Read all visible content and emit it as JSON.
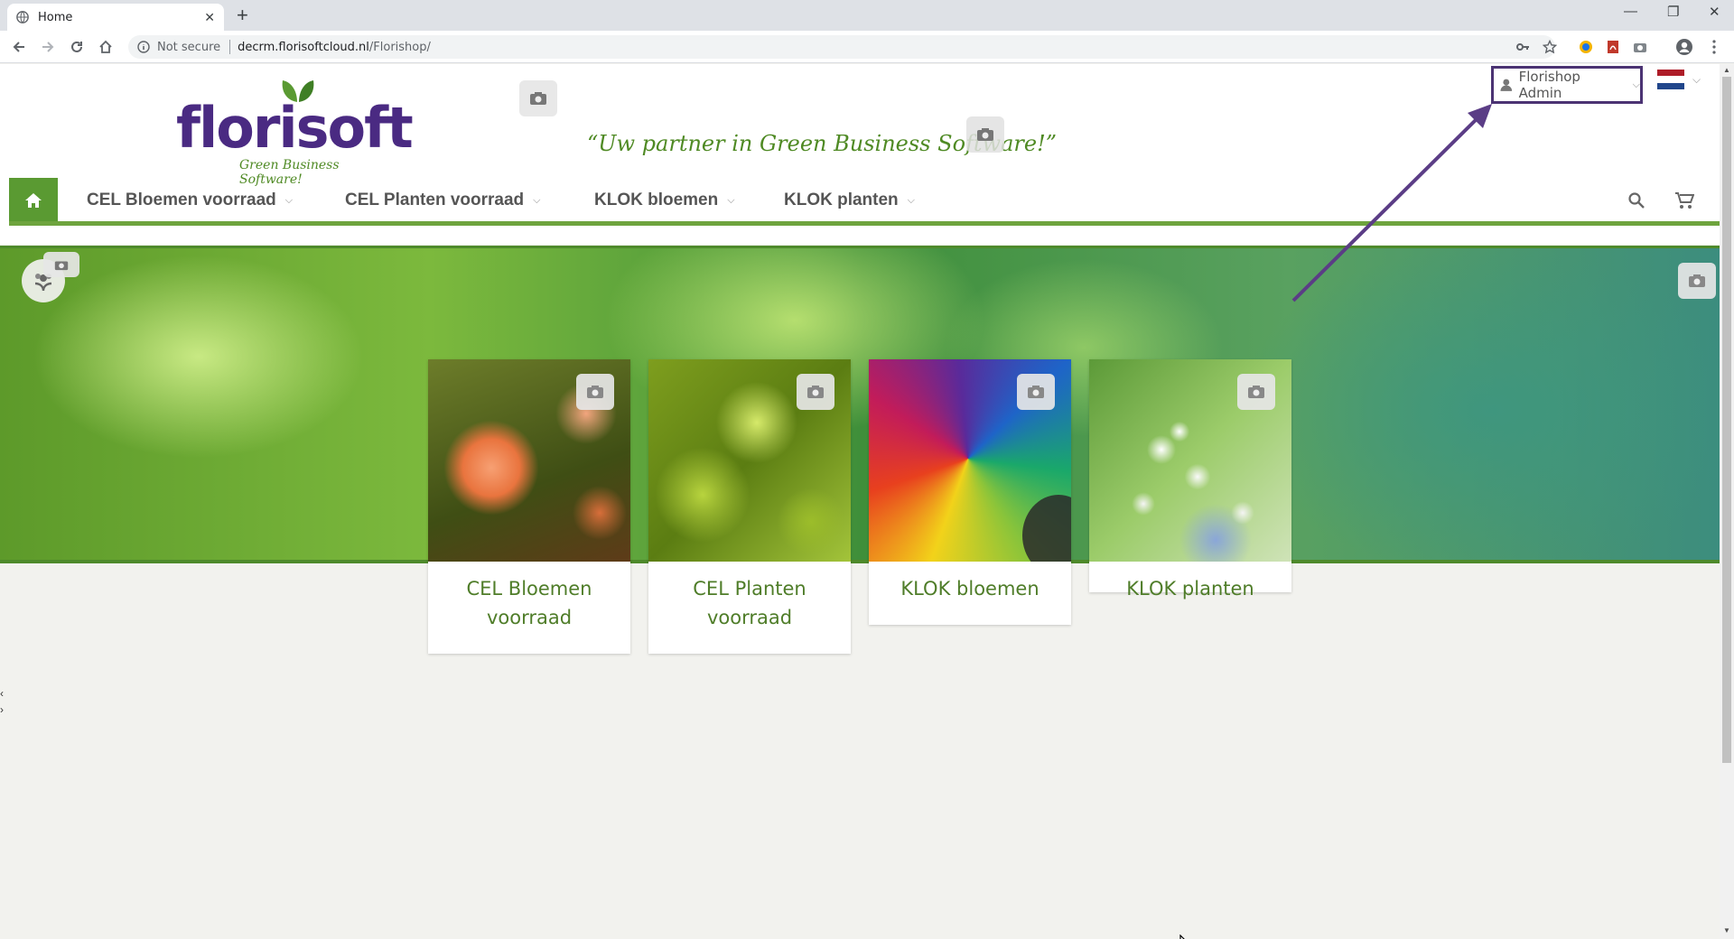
{
  "browser": {
    "tab_title": "Home",
    "address_not_secure": "Not secure",
    "address_host": "decrm.florisoftcloud.nl",
    "address_path": "/Florishop/"
  },
  "header": {
    "logo_text": "florisoft",
    "logo_tagline": "Green Business Software!",
    "slogan": "“Uw partner in Green Business Software!”",
    "user_name": "Florishop Admin"
  },
  "nav": {
    "items": [
      {
        "label": "CEL Bloemen voorraad"
      },
      {
        "label": "CEL Planten voorraad"
      },
      {
        "label": "KLOK bloemen"
      },
      {
        "label": "KLOK planten"
      }
    ]
  },
  "categories": [
    {
      "label": "CEL Bloemen voorraad",
      "image": "orange-roses"
    },
    {
      "label": "CEL Planten voorraad",
      "image": "green-plant"
    },
    {
      "label": "KLOK bloemen",
      "image": "rainbow-rose"
    },
    {
      "label": "KLOK planten",
      "image": "lily-of-the-valley"
    }
  ],
  "colors": {
    "brand_purple": "#4a2a82",
    "brand_green": "#5a9a32",
    "label_green": "#4f7d29",
    "annotation_purple": "#5b3d86"
  }
}
